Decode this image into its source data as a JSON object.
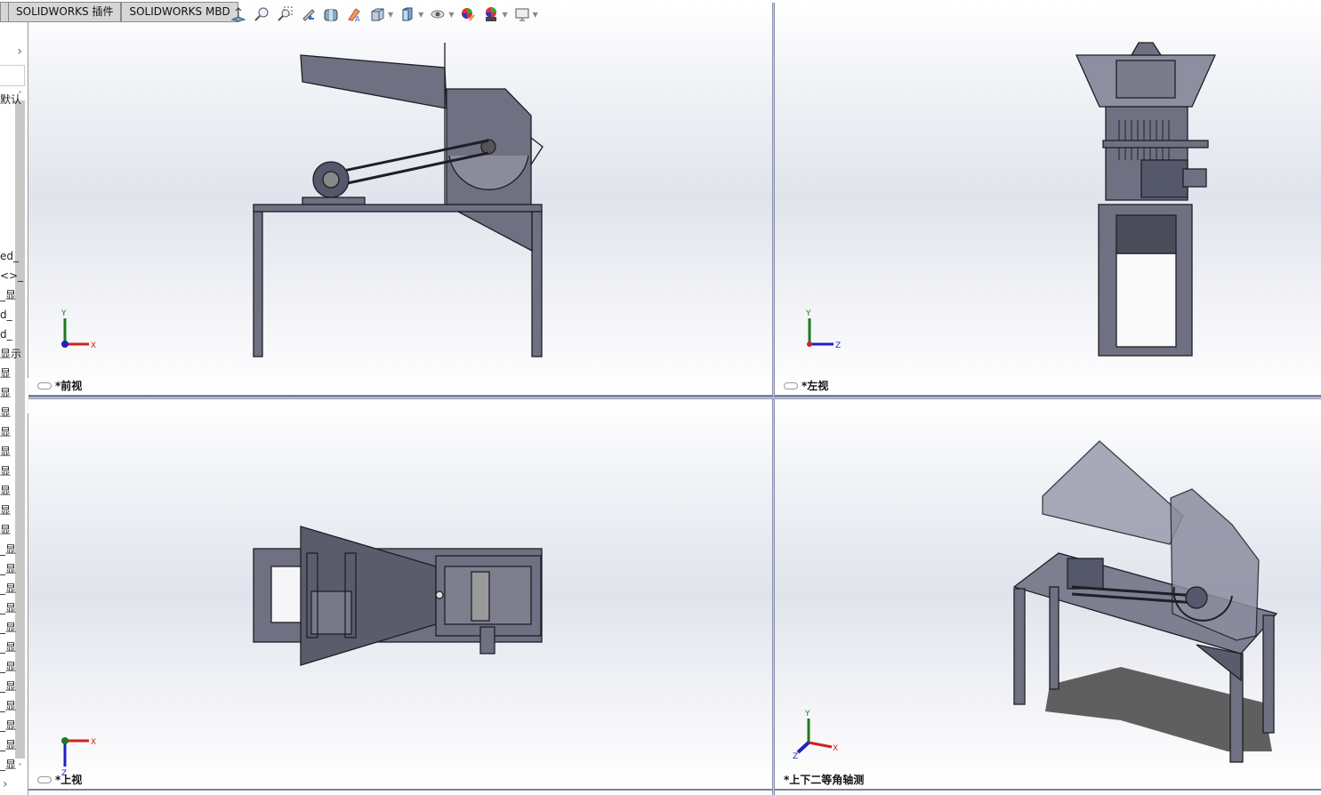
{
  "tabs": [
    {
      "label": "SOLIDWORKS 插件"
    },
    {
      "label": "SOLIDWORKS MBD"
    }
  ],
  "toolbar": {
    "icons": [
      "normal-to-icon",
      "zoom-to-fit-icon",
      "zoom-to-area-icon",
      "previous-view-icon",
      "section-view-icon",
      "dynamic-annotation-icon",
      "view-orientation-icon",
      "display-style-icon",
      "hide-show-items-icon",
      "edit-appearance-icon",
      "apply-scene-icon",
      "view-settings-icon"
    ]
  },
  "left_panel": {
    "items": [
      "默认",
      "ed_",
      "<>_",
      "_显",
      "d_",
      "d_",
      "显示",
      "显",
      "显",
      "显",
      "显",
      "显",
      "显",
      "显",
      "显",
      "显",
      "_显",
      "_显",
      "_显",
      "_显",
      "_显",
      "_显",
      "_显",
      "_显",
      "_显",
      "_显",
      "_显",
      "_显"
    ]
  },
  "viewports": [
    {
      "label": "*前视",
      "triad": {
        "axis1": "Y",
        "axis2": "X",
        "axis3": "Z"
      }
    },
    {
      "label": "*左视",
      "triad": {
        "axis1": "Y",
        "axis2": "Z",
        "axis3": "X"
      }
    },
    {
      "label": "*上视",
      "triad": {
        "axis1": "X",
        "axis2": "Z",
        "axis3": "Y"
      }
    },
    {
      "label": "*上下二等角轴测",
      "triad": {
        "axis1": "Y",
        "axis2": "X",
        "axis3": "Z"
      }
    }
  ],
  "colors": {
    "model_fill": "#6f7182",
    "model_glass": "#9a9cae",
    "axis_x": "#d02020",
    "axis_y": "#1e7a1e",
    "axis_z": "#2020c0"
  }
}
